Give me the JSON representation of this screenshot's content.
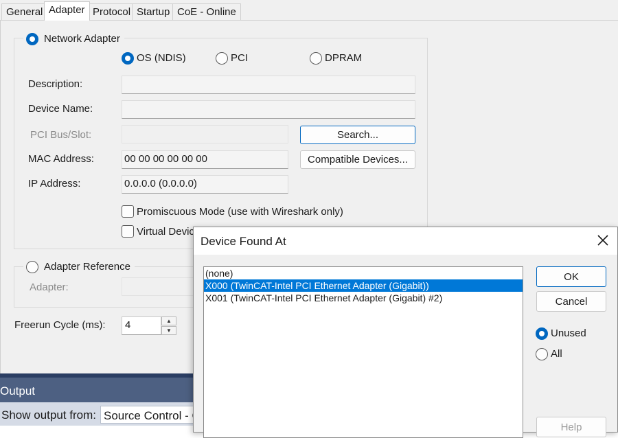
{
  "tabs": [
    "General",
    "Adapter",
    "Protocol",
    "Startup",
    "CoE - Online"
  ],
  "active_tab": "Adapter",
  "network_adapter": {
    "label": "Network Adapter",
    "options": [
      "OS (NDIS)",
      "PCI",
      "DPRAM"
    ],
    "selected": "OS (NDIS)",
    "description_label": "Description:",
    "description_value": "",
    "device_name_label": "Device Name:",
    "device_name_value": "",
    "pci_label": "PCI Bus/Slot:",
    "pci_value": "",
    "mac_label": "MAC Address:",
    "mac_value": "00 00 00 00 00 00",
    "ip_label": "IP Address:",
    "ip_value": "0.0.0.0 (0.0.0.0)",
    "search_button": "Search...",
    "compatible_button": "Compatible Devices...",
    "promiscuous_label": "Promiscuous Mode (use with Wireshark only)",
    "virtual_label": "Virtual Device"
  },
  "adapter_reference": {
    "label": "Adapter Reference",
    "adapter_label": "Adapter:",
    "adapter_value": ""
  },
  "freerun": {
    "label": "Freerun Cycle (ms):",
    "value": "4"
  },
  "output": {
    "title": "Output",
    "show_from_label": "Show output from:",
    "source_value": "Source Control - Git"
  },
  "dialog": {
    "title": "Device Found At",
    "items": [
      "(none)",
      "X000 (TwinCAT-Intel PCI Ethernet Adapter (Gigabit))",
      "X001 (TwinCAT-Intel PCI Ethernet Adapter (Gigabit) #2)"
    ],
    "selected_index": 1,
    "ok_button": "OK",
    "cancel_button": "Cancel",
    "filter_options": [
      "Unused",
      "All"
    ],
    "filter_selected": "Unused",
    "help_button": "Help"
  },
  "colors": {
    "accent": "#0067c0",
    "selection": "#0078d7",
    "output_title_bg": "#4d6082"
  }
}
